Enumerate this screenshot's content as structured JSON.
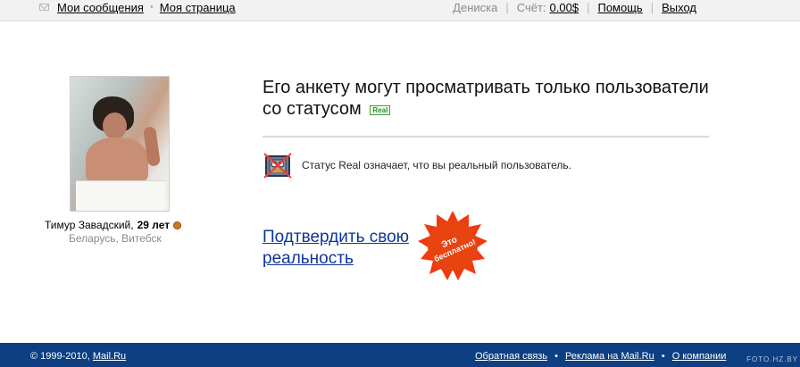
{
  "topbar": {
    "messages": "Мои сообщения",
    "my_page": "Моя страница",
    "username": "Дениска",
    "account_label": "Счёт:",
    "account_value": "0.00$",
    "help": "Помощь",
    "logout": "Выход"
  },
  "profile": {
    "name": "Тимур Завадский,",
    "age": "29 лет",
    "location": "Беларусь, Витебск"
  },
  "content": {
    "headline": "Его анкету могут просматривать только пользователи со статусом",
    "badge": "Real",
    "status_desc": "Статус Real означает, что вы реальный пользователь.",
    "confirm_link": "Подтвердить свою реальность",
    "seal_text_1": "Это",
    "seal_text_2": "бесплатно!"
  },
  "footer": {
    "copyright": "© 1999-2010,",
    "site": "Mail.Ru",
    "feedback": "Обратная связь",
    "ads": "Реклама на Mail.Ru",
    "about": "О компании",
    "watermark": "FOTO.HZ.BY"
  },
  "colors": {
    "link": "#0f3597",
    "footer": "#0d3f82",
    "badge": "#289028",
    "seal": "#ef3b12"
  },
  "icons": [
    "mail-icon",
    "robot-status-icon",
    "status-icon-small"
  ]
}
